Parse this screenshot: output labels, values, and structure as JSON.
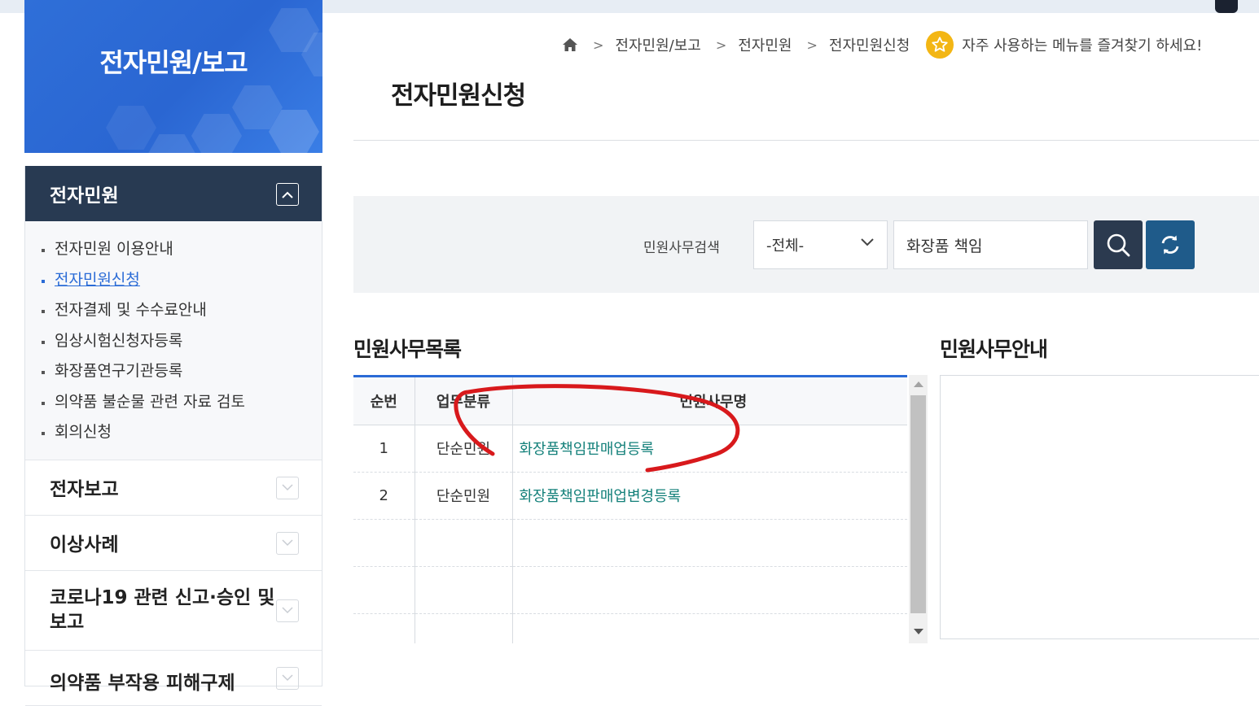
{
  "banner": {
    "title": "전자민원/보고"
  },
  "sidebar": {
    "section_title": "전자민원",
    "submenu": [
      {
        "label": "전자민원 이용안내",
        "active": false
      },
      {
        "label": "전자민원신청",
        "active": true
      },
      {
        "label": "전자결제 및 수수료안내",
        "active": false
      },
      {
        "label": "임상시험신청자등록",
        "active": false
      },
      {
        "label": "화장품연구기관등록",
        "active": false
      },
      {
        "label": "의약품 불순물 관련 자료 검토",
        "active": false
      },
      {
        "label": "회의신청",
        "active": false
      }
    ],
    "sections": [
      {
        "label": "전자보고"
      },
      {
        "label": "이상사례"
      },
      {
        "label": "코로나19 관련 신고·승인 및 보고"
      },
      {
        "label": "의약품 부작용 피해구제"
      }
    ]
  },
  "breadcrumb": {
    "home_icon": "home-icon",
    "items": [
      "전자민원/보고",
      "전자민원",
      "전자민원신청"
    ],
    "favorite_text": "자주 사용하는 메뉴를 즐겨찾기 하세요!"
  },
  "page": {
    "title": "전자민원신청"
  },
  "search": {
    "label": "민원사무검색",
    "category_selected": "-전체-",
    "query": "화장품 책임",
    "search_icon": "search-icon",
    "reset_icon": "refresh-icon"
  },
  "list": {
    "title": "민원사무목록",
    "columns": [
      "순번",
      "업무분류",
      "민원사무명"
    ],
    "rows": [
      {
        "no": "1",
        "category": "단순민원",
        "name": "화장품책임판매업등록"
      },
      {
        "no": "2",
        "category": "단순민원",
        "name": "화장품책임판매업변경등록"
      }
    ]
  },
  "guide": {
    "title": "민원사무안내"
  },
  "colors": {
    "banner": "#2f6fd8",
    "sidebar_header": "#283a52",
    "link_teal": "#13807a",
    "table_accent": "#2a6bd6",
    "search_button": "#2b3a4f",
    "reset_button": "#1f5b8a",
    "star": "#f3b614",
    "annotation": "#d8191c"
  }
}
